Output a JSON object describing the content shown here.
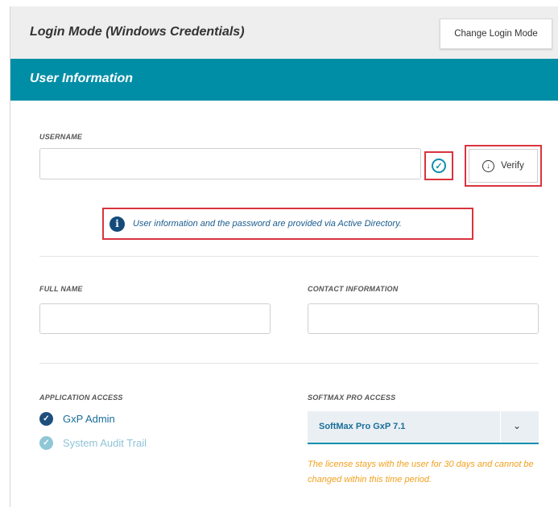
{
  "login_mode": {
    "title": "Login Mode (Windows Credentials)",
    "change_button": "Change Login Mode"
  },
  "user_info": {
    "section_title": "User Information",
    "username_label": "USERNAME",
    "username_value": "",
    "verify_label": "Verify",
    "info_message": "User information and the password are provided via Active Directory.",
    "full_name_label": "FULL NAME",
    "full_name_value": "",
    "contact_label": "CONTACT INFORMATION",
    "contact_value": ""
  },
  "application_access": {
    "label": "APPLICATION ACCESS",
    "items": [
      {
        "label": "GxP Admin",
        "checked": true,
        "enabled": true
      },
      {
        "label": "System Audit Trail",
        "checked": true,
        "enabled": false
      }
    ]
  },
  "softmax_access": {
    "label": "SOFTMAX PRO ACCESS",
    "selected": "SoftMax Pro GxP 7.1",
    "note": "The license stays with the user for 30 days and cannot be changed within this time period."
  },
  "colors": {
    "accent": "#008ea6",
    "highlight": "#d9343e",
    "warning": "#f2a11e",
    "info_text": "#1b5c8f"
  }
}
